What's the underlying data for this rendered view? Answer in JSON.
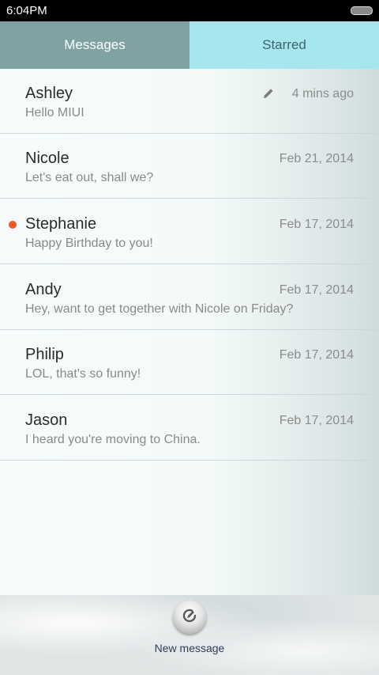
{
  "status_bar": {
    "time": "6:04PM"
  },
  "tabs": [
    {
      "label": "Messages",
      "active": true
    },
    {
      "label": "Starred",
      "active": false
    }
  ],
  "messages": [
    {
      "name": "Ashley",
      "preview": "Hello MIUI",
      "date": "4 mins ago",
      "draft": true,
      "unread": false
    },
    {
      "name": "Nicole",
      "preview": "Let's eat out, shall we?",
      "date": "Feb 21, 2014",
      "draft": false,
      "unread": false
    },
    {
      "name": "Stephanie",
      "preview": "Happy Birthday to you!",
      "date": "Feb 17, 2014",
      "draft": false,
      "unread": true
    },
    {
      "name": "Andy",
      "preview": "Hey, want to get together with Nicole on Friday?",
      "date": "Feb 17, 2014",
      "draft": false,
      "unread": false
    },
    {
      "name": "Philip",
      "preview": "LOL, that's so funny!",
      "date": "Feb 17, 2014",
      "draft": false,
      "unread": false
    },
    {
      "name": "Jason",
      "preview": "I heard you're moving to China.",
      "date": "Feb 17, 2014",
      "draft": false,
      "unread": false
    }
  ],
  "bottom_bar": {
    "new_message_label": "New message",
    "new_message_icon": "compose-icon"
  },
  "colors": {
    "unread_dot": "#ee5a24",
    "active_tab": "#7fa3a3",
    "inactive_tab": "#a6e6ec"
  }
}
